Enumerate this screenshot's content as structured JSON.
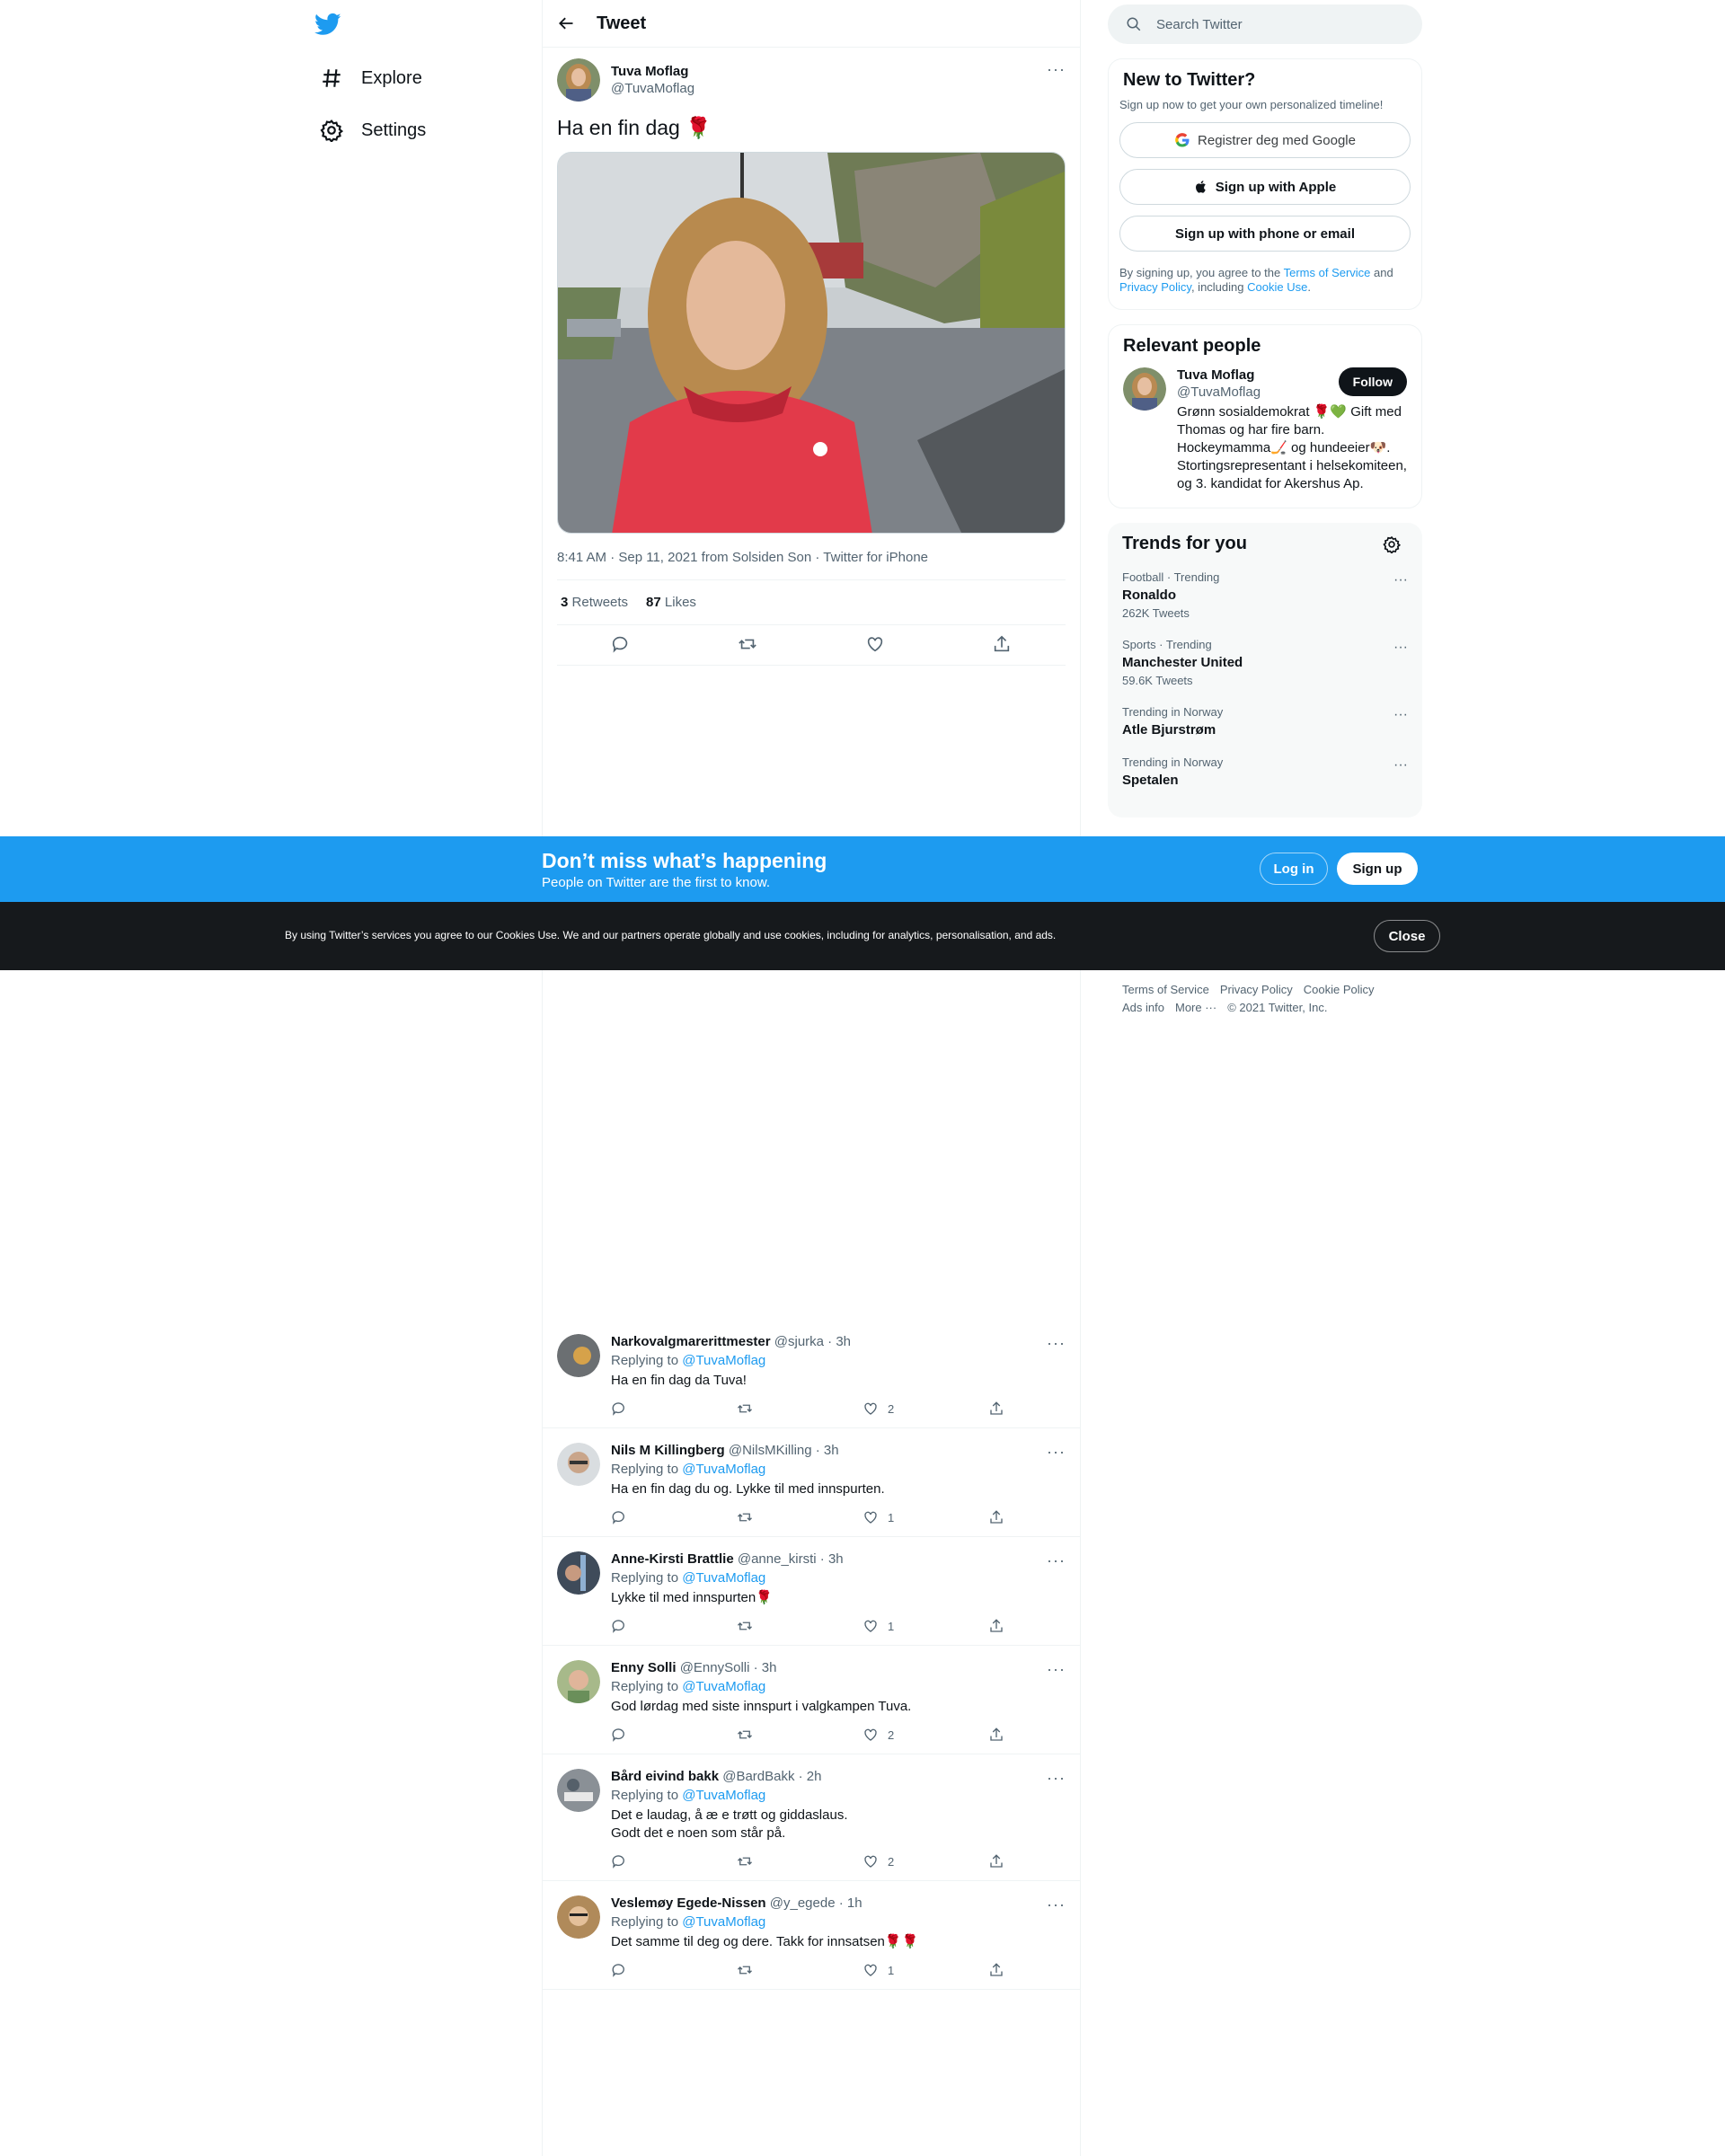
{
  "nav": {
    "explore": "Explore",
    "settings": "Settings"
  },
  "header": {
    "title": "Tweet"
  },
  "tweet": {
    "author_name": "Tuva Moflag",
    "author_handle": "@TuvaMoflag",
    "text": "Ha en fin dag 🌹",
    "meta": "8:41 AM · Sep 11, 2021 from Solsiden Son · Twitter for iPhone",
    "retweets_count": "3",
    "retweets_label": "Retweets",
    "likes_count": "87",
    "likes_label": "Likes"
  },
  "replies": [
    {
      "name": "Narkovalgmarerittmester",
      "handle": "@sjurka · 3h",
      "replying": "Replying to",
      "to": "@TuvaMoflag",
      "text": "Ha en fin dag da Tuva!",
      "likes": "2"
    },
    {
      "name": "Nils M Killingberg",
      "handle": "@NilsMKilling · 3h",
      "replying": "Replying to",
      "to": "@TuvaMoflag",
      "text": "Ha en fin dag du og. Lykke til med innspurten.",
      "likes": "1"
    },
    {
      "name": "Anne-Kirsti Brattlie",
      "handle": "@anne_kirsti · 3h",
      "replying": "Replying to",
      "to": "@TuvaMoflag",
      "text": "Lykke til med innspurten🌹",
      "likes": "1"
    },
    {
      "name": "Enny Solli",
      "handle": "@EnnySolli · 3h",
      "replying": "Replying to",
      "to": "@TuvaMoflag",
      "text": "God lørdag med siste innspurt i valgkampen Tuva.",
      "likes": "2"
    },
    {
      "name": "Bård eivind bakk",
      "handle": "@BardBakk · 2h",
      "replying": "Replying to",
      "to": "@TuvaMoflag",
      "text": "Det e laudag, å æ e trøtt og giddaslaus.",
      "text2": "Godt det e noen som står på.",
      "likes": "2"
    },
    {
      "name": "Veslemøy Egede-Nissen",
      "handle": "@y_egede · 1h",
      "replying": "Replying to",
      "to": "@TuvaMoflag",
      "text": "Det samme til deg og dere. Takk for innsatsen🌹🌹",
      "likes": "1"
    }
  ],
  "search": {
    "placeholder": "Search Twitter"
  },
  "signup": {
    "title": "New to Twitter?",
    "subtitle": "Sign up now to get your own personalized timeline!",
    "google": "Registrer deg med Google",
    "apple": "Sign up with Apple",
    "phone": "Sign up with phone or email",
    "legal_1": "By signing up, you agree to the ",
    "terms": "Terms of Service",
    "legal_2": " and ",
    "privacy": "Privacy Policy",
    "legal_3": ", including ",
    "cookie": "Cookie Use",
    "legal_4": "."
  },
  "relevant": {
    "title": "Relevant people",
    "name": "Tuva Moflag",
    "handle": "@TuvaMoflag",
    "follow": "Follow",
    "bio": "Grønn sosialdemokrat 🌹💚 Gift med Thomas og har fire barn. Hockeymamma🏒 og hundeeier🐶. Stortingsrepresentant i helsekomiteen, og 3. kandidat for Akershus Ap."
  },
  "trends": {
    "title": "Trends for you",
    "items": [
      {
        "cat": "Football · Trending",
        "name": "Ronaldo",
        "count": "262K Tweets"
      },
      {
        "cat": "Sports · Trending",
        "name": "Manchester United",
        "count": "59.6K Tweets"
      },
      {
        "cat": "Trending in Norway",
        "name": "Atle Bjurstrøm",
        "count": ""
      },
      {
        "cat": "Trending in Norway",
        "name": "Spetalen",
        "count": ""
      }
    ]
  },
  "footer": {
    "terms": "Terms of Service",
    "privacy": "Privacy Policy",
    "cookie": "Cookie Policy",
    "ads": "Ads info",
    "more": "More ···",
    "copyright": "© 2021 Twitter, Inc."
  },
  "promo": {
    "title": "Don’t miss what’s happening",
    "subtitle": "People on Twitter are the first to know.",
    "login": "Log in",
    "signup": "Sign up"
  },
  "cookie_bar": {
    "text": "By using Twitter’s services you agree to our Cookies Use. We and our partners operate globally and use cookies, including for analytics, personalisation, and ads.",
    "close": "Close"
  },
  "colors": {
    "accent": "#1d9bf0",
    "dark": "#0f1419",
    "cookie_bg": "#16191c"
  }
}
